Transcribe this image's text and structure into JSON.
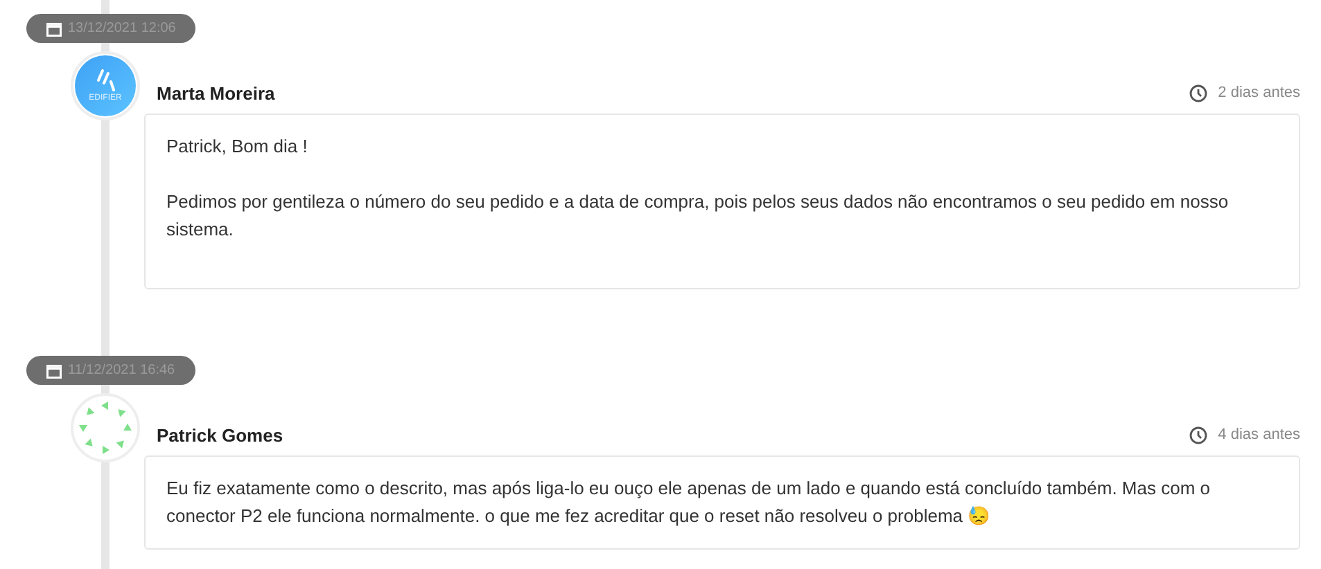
{
  "entries": [
    {
      "date": "13/12/2021 12:06",
      "author": "Marta Moreira",
      "avatar": {
        "kind": "logo",
        "label": "EDIFIER"
      },
      "time": "2 dias antes",
      "paragraphs": [
        "Patrick, Bom dia !",
        "Pedimos por gentileza o número do seu pedido e a data de compra, pois pelos seus dados não encontramos o seu pedido em nosso sistema."
      ]
    },
    {
      "date": "11/12/2021 16:46",
      "author": "Patrick Gomes",
      "avatar": {
        "kind": "pattern"
      },
      "time": "4 dias antes",
      "paragraphs": [
        "Eu fiz exatamente como o descrito, mas após liga-lo eu ouço ele apenas de um lado e quando está concluído também. Mas com o conector P2 ele funciona normalmente. o que me fez acreditar que o reset não resolveu o problema 😓"
      ]
    }
  ]
}
